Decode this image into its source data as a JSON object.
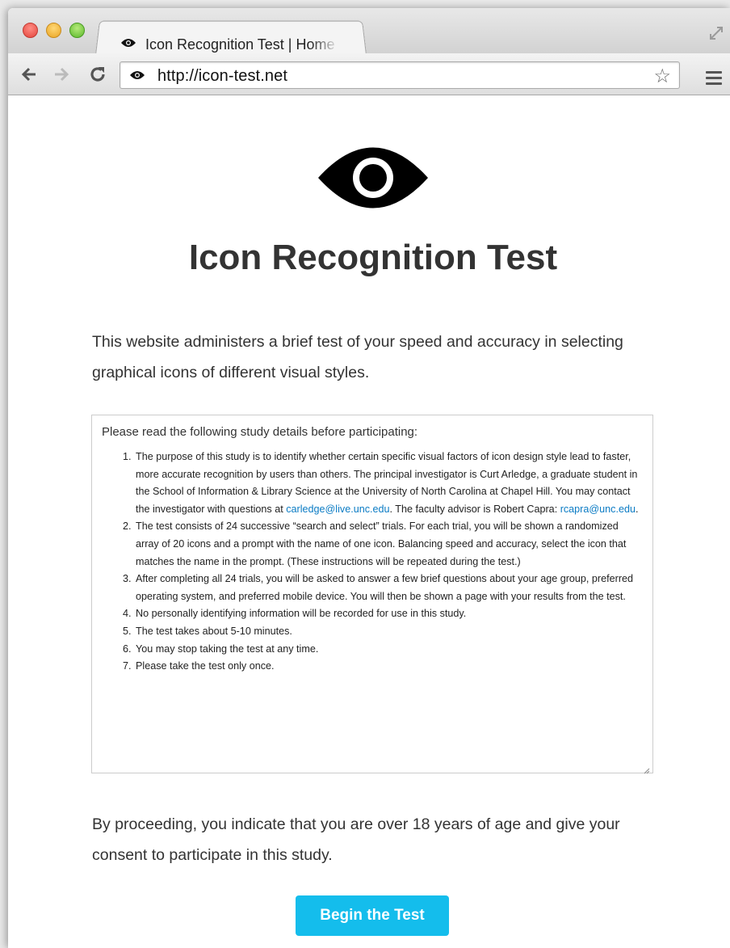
{
  "browser": {
    "tab_title": "Icon Recognition Test | Home",
    "url": "http://icon-test.net",
    "icons": {
      "favicon": "eye-icon",
      "back": "arrow-left-icon",
      "forward": "arrow-right-icon",
      "reload": "reload-icon",
      "bookmark": "star-icon",
      "menu": "hamburger-menu-icon",
      "fullscreen": "fullscreen-icon"
    }
  },
  "page": {
    "logo_icon": "eye-icon",
    "title": "Icon Recognition Test",
    "intro": "This website administers a brief test of your speed and accuracy in selecting graphical icons of different visual styles.",
    "details": {
      "heading": "Please read the following study details before participating:",
      "item1_text": "The purpose of this study is to identify whether certain specific visual factors of icon design style lead to faster, more accurate recognition by users than others. The principal investigator is Curt Arledge, a graduate student in the School of Information & Library Science at the University of North Carolina at Chapel Hill. You may contact the investigator with questions at ",
      "item1_email1": "carledge@live.unc.edu",
      "item1_mid": ". The faculty advisor is Robert Capra: ",
      "item1_email2": "rcapra@unc.edu",
      "item1_end": ".",
      "item2": "The test consists of 24 successive “search and select” trials. For each trial, you will be shown a randomized array of 20 icons and a prompt with the name of one icon. Balancing speed and accuracy, select the icon that matches the name in the prompt. (These instructions will be repeated during the test.)",
      "item3": "After completing all 24 trials, you will be asked to answer a few brief questions about your age group, preferred operating system, and preferred mobile device. You will then be shown a page with your results from the test.",
      "item4": "No personally identifying information will be recorded for use in this study.",
      "item5": "The test takes about 5-10 minutes.",
      "item6": "You may stop taking the test at any time.",
      "item7": "Please take the test only once."
    },
    "consent": "By proceeding, you indicate that you are over 18 years of age and give your consent to participate in this study.",
    "begin_button": "Begin the Test"
  },
  "colors": {
    "button": "#14bdec",
    "link": "#0a7bc4",
    "text": "#333333"
  }
}
